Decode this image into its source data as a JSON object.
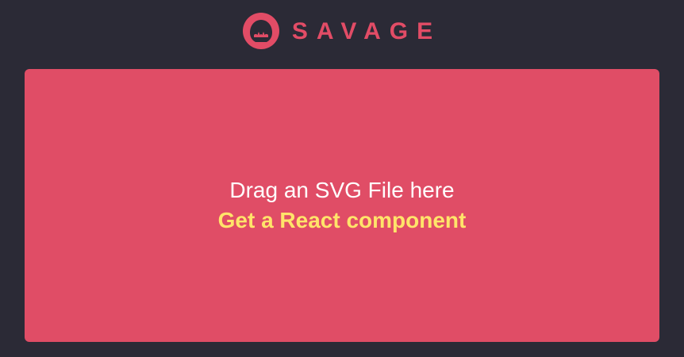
{
  "app": {
    "brand_name": "SAVAGE",
    "logo_icon": "shark-logo-icon"
  },
  "dropzone": {
    "primary_text": "Drag an SVG File here",
    "secondary_text": "Get a React component"
  },
  "colors": {
    "background": "#2b2a36",
    "accent": "#e04d66",
    "highlight": "#ffe46a",
    "text": "#ffffff"
  }
}
